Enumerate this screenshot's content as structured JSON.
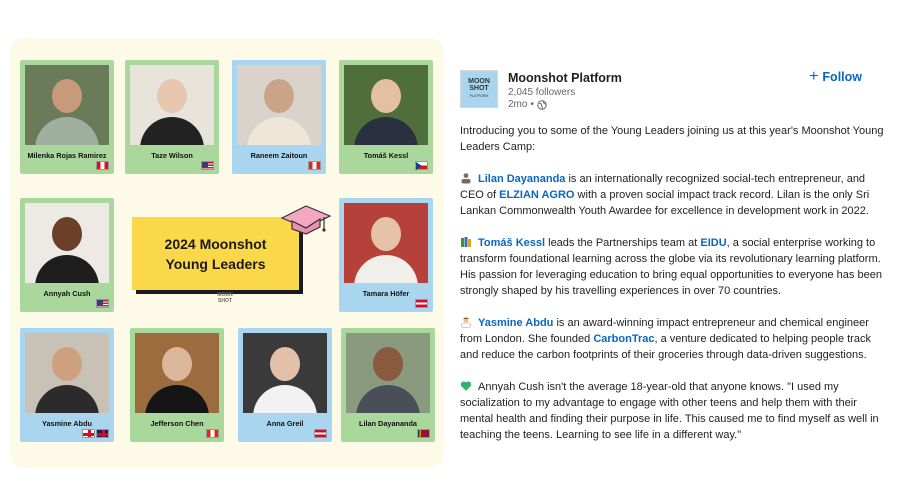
{
  "graphic": {
    "title_line1": "2024 Moonshot",
    "title_line2": "Young Leaders",
    "mini_logo_line1": "MOON",
    "mini_logo_line2": "SHOT",
    "cards": [
      {
        "name": "Milenka Rojas Ramirez",
        "flag": "peru",
        "color": "green"
      },
      {
        "name": "Taze Wilson",
        "flag": "usa",
        "color": "green"
      },
      {
        "name": "Raneem Zaitoun",
        "flag": "canada",
        "color": "blue"
      },
      {
        "name": "Tomáš Kessl",
        "flag": "czechia",
        "color": "green"
      },
      {
        "name": "Annyah Cush",
        "flag": "usa",
        "color": "green"
      },
      {
        "name": "Tamara Höfer",
        "flag": "austria",
        "color": "blue"
      },
      {
        "name": "Yasmine Abdu",
        "flag": "england-uk",
        "color": "blue"
      },
      {
        "name": "Jefferson Chen",
        "flag": "canada",
        "color": "green"
      },
      {
        "name": "Anna Greil",
        "flag": "austria",
        "color": "blue"
      },
      {
        "name": "Lilan Dayananda",
        "flag": "sri-lanka",
        "color": "green"
      }
    ]
  },
  "post": {
    "org_name": "Moonshot Platform",
    "logo_line1": "MOON",
    "logo_line2": "SHOT",
    "logo_line3": "PLATFORM",
    "followers": "2,045 followers",
    "time": "2mo",
    "follow_label": "Follow",
    "intro": "Introducing you to some of the Young Leaders joining us at this year's Moonshot Young Leaders Camp:",
    "p1": {
      "mention": "Lilan Dayananda",
      "text_a": " is an internationally recognized social-tech entrepreneur, and CEO of ",
      "org": "ELZIAN AGRO",
      "text_b": " with a proven social impact track record. Lilan is the only Sri Lankan Commonwealth Youth Awardee for excellence in development work in 2022."
    },
    "p2": {
      "mention": "Tomáš Kessl",
      "text_a": " leads the Partnerships team at ",
      "org": "EIDU",
      "text_b": ", a social enterprise working to transform foundational learning across the globe via its revolutionary learning platform. His passion for leveraging education to bring equal opportunities to everyone has been strongly shaped by his travelling experiences in over 70 countries."
    },
    "p3": {
      "mention": "Yasmine Abdu",
      "text_a": " is an award-winning impact entrepreneur and chemical engineer from London. She founded ",
      "org": "CarbonTrac",
      "text_b": ", a venture dedicated to helping people track and reduce the carbon footprints of their groceries through data-driven suggestions."
    },
    "p4": {
      "text": "Annyah Cush isn't the average 18-year-old that anyone knows. \"I used my socialization to my advantage to engage with other teens and help them with their mental health and finding their purpose in life. This caused me to find myself as well in teaching the teens. Learning to see life in a different way.\""
    }
  },
  "colors": {
    "accent": "#0a66c2",
    "card_green": "#a9d79c",
    "card_blue": "#a9d6ee",
    "title_yellow": "#fbd84a",
    "graphic_bg": "#fdfbe8"
  }
}
